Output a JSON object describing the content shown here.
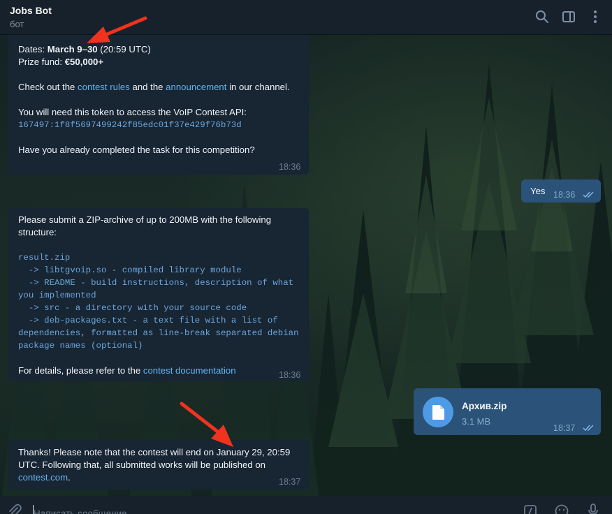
{
  "chat": {
    "title": "Jobs Bot",
    "subtitle": "бот"
  },
  "icons": {
    "search": "search-icon",
    "sidebar": "sidebar-toggle-icon",
    "more": "more-vertical-icon",
    "attach": "paperclip-icon",
    "commands": "bot-commands-icon",
    "emoji": "emoji-icon",
    "mic": "microphone-icon",
    "file": "file-icon",
    "read": "double-check-icon"
  },
  "messages": {
    "m1": {
      "dates_label": "Dates: ",
      "dates_value": "March 9–30",
      "dates_suffix": " (20:59 UTC)",
      "prize_label": "Prize fund: ",
      "prize_value": "€50,000+",
      "check_prefix": "Check out the ",
      "rules_link": "contest rules",
      "check_mid": " and the ",
      "announcement_link": "announcement",
      "check_suffix": " in our channel.",
      "token_intro": "You will need this token to access the VoIP Contest API:",
      "token": "167497:1f8f5697499242f85edc01f37e429f76b73d",
      "question": "Have you already completed the task for this competition?",
      "time": "18:36"
    },
    "m2": {
      "text": "Yes",
      "time": "18:36"
    },
    "m3": {
      "intro": "Please submit a ZIP-archive of up to 200MB with the following structure:",
      "code_lines": [
        "result.zip",
        "  -> libtgvoip.so - compiled library module",
        "  -> README - build instructions, description of what",
        "you implemented",
        "  -> src - a directory with your source code",
        "  -> deb-packages.txt - a text file with a list of",
        "dependencies, formatted as line-break separated debian",
        "package names (optional)"
      ],
      "details_prefix": "For details, please refer to the ",
      "details_link": "contest documentation",
      "time": "18:36"
    },
    "m4": {
      "file_name": "Архив.zip",
      "file_size": "3.1 MB",
      "time": "18:37"
    },
    "m5": {
      "line1": "Thanks! Please note that the contest will end on January 29, 20:59",
      "line2": "UTC. Following that, all submitted works will be published on",
      "link": "contest.com",
      "link_suffix": ".",
      "time": "18:37"
    }
  },
  "composer": {
    "placeholder": "Написать сообщение..."
  },
  "colors": {
    "header_bg": "#17212b",
    "incoming_bubble": "#182533",
    "outgoing_bubble": "#2b5278",
    "link": "#64b5ef",
    "annotation_arrow": "#f0321e"
  }
}
